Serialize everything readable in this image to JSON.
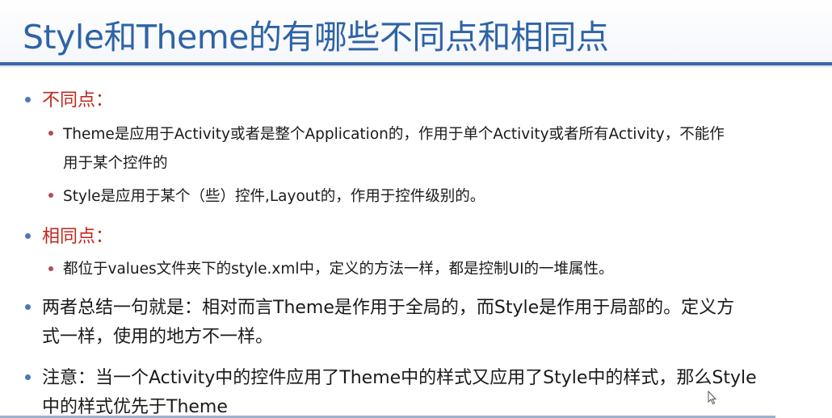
{
  "slide": {
    "title": "Style和Theme的有哪些不同点和相同点",
    "items": [
      {
        "level": 1,
        "color": "#c0281f",
        "text": "不同点："
      },
      {
        "level": 2,
        "lines": [
          "Theme是应用于Activity或者是整个Application的，作用于单个Activity或者所有Activity，不能作",
          "用于某个控件的"
        ]
      },
      {
        "level": 2,
        "lines": [
          "Style是应用于某个（些）控件,Layout的，作用于控件级别的。"
        ]
      },
      {
        "level": 1,
        "color": "#c0281f",
        "text": "相同点："
      },
      {
        "level": 2,
        "lines": [
          "都位于values文件夹下的style.xml中，定义的方法一样，都是控制UI的一堆属性。"
        ]
      },
      {
        "level": 1,
        "lines": [
          "两者总结一句就是：相对而言Theme是作用于全局的，而Style是作用于局部的。定义方",
          "式一样，使用的地方不一样。"
        ]
      },
      {
        "level": 1,
        "lines": [
          "注意：当一个Activity中的控件应用了Theme中的样式又应用了Style中的样式，那么Style",
          "中的样式优先于Theme"
        ]
      }
    ]
  },
  "colors": {
    "title": "#2e63a6",
    "accent_rule": "#3a67a8",
    "heading_red": "#c0281f",
    "bullet_level1": "#4a78b8",
    "bullet_level2": "#b84a4a",
    "body_text": "#1a1a1a"
  },
  "icons": {
    "cursor": "mouse-pointer-icon"
  }
}
